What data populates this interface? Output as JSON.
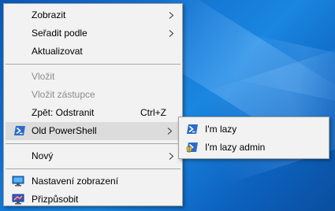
{
  "context_menu": {
    "items": [
      {
        "label": "Zobrazit"
      },
      {
        "label": "Seřadit podle"
      },
      {
        "label": "Aktualizovat"
      },
      {
        "label": "Vložit"
      },
      {
        "label": "Vložit zástupce"
      },
      {
        "label": "Zpět: Odstranit",
        "shortcut": "Ctrl+Z"
      },
      {
        "label": "Old PowerShell"
      },
      {
        "label": "Nový"
      },
      {
        "label": "Nastavení zobrazení"
      },
      {
        "label": "Přizpůsobit"
      }
    ]
  },
  "submenu": {
    "items": [
      {
        "label": "I'm lazy"
      },
      {
        "label": "I'm lazy admin"
      }
    ]
  },
  "colors": {
    "menu_bg": "#f2f2f2",
    "highlight": "#dcdcdc",
    "disabled_text": "#8c8c8c",
    "desktop": "#1270cf"
  }
}
